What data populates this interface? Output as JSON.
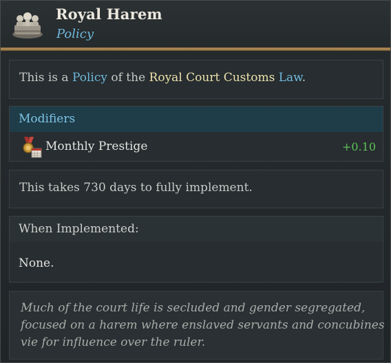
{
  "header": {
    "icon": "royal-court-icon",
    "title": "Royal Harem",
    "subtitle": "Policy"
  },
  "intro": {
    "prefix": "This is a ",
    "policy_word": "Policy",
    "middle": " of the ",
    "law_name": "Royal Court Customs",
    "space": " ",
    "law_word": "Law",
    "suffix": "."
  },
  "modifiers": {
    "heading": "Modifiers",
    "items": [
      {
        "icon": "prestige-medal-icon",
        "label": "Monthly Prestige",
        "value": "+0.10"
      }
    ]
  },
  "implementation": {
    "text": "This takes 730 days to fully implement."
  },
  "when_implemented": {
    "heading": "When Implemented:",
    "value": "None."
  },
  "description": {
    "lines": [
      "Much of the court life is secluded and gender segregated,",
      "focused on a harem where enslaved servants and concubines",
      "vie for influence over the ruler."
    ]
  },
  "colors": {
    "accent_blue": "#6fb9dc",
    "highlight_gold": "#eee2ae",
    "positive_green": "#5fc05a",
    "header_divider_gold": "#b4915a"
  }
}
